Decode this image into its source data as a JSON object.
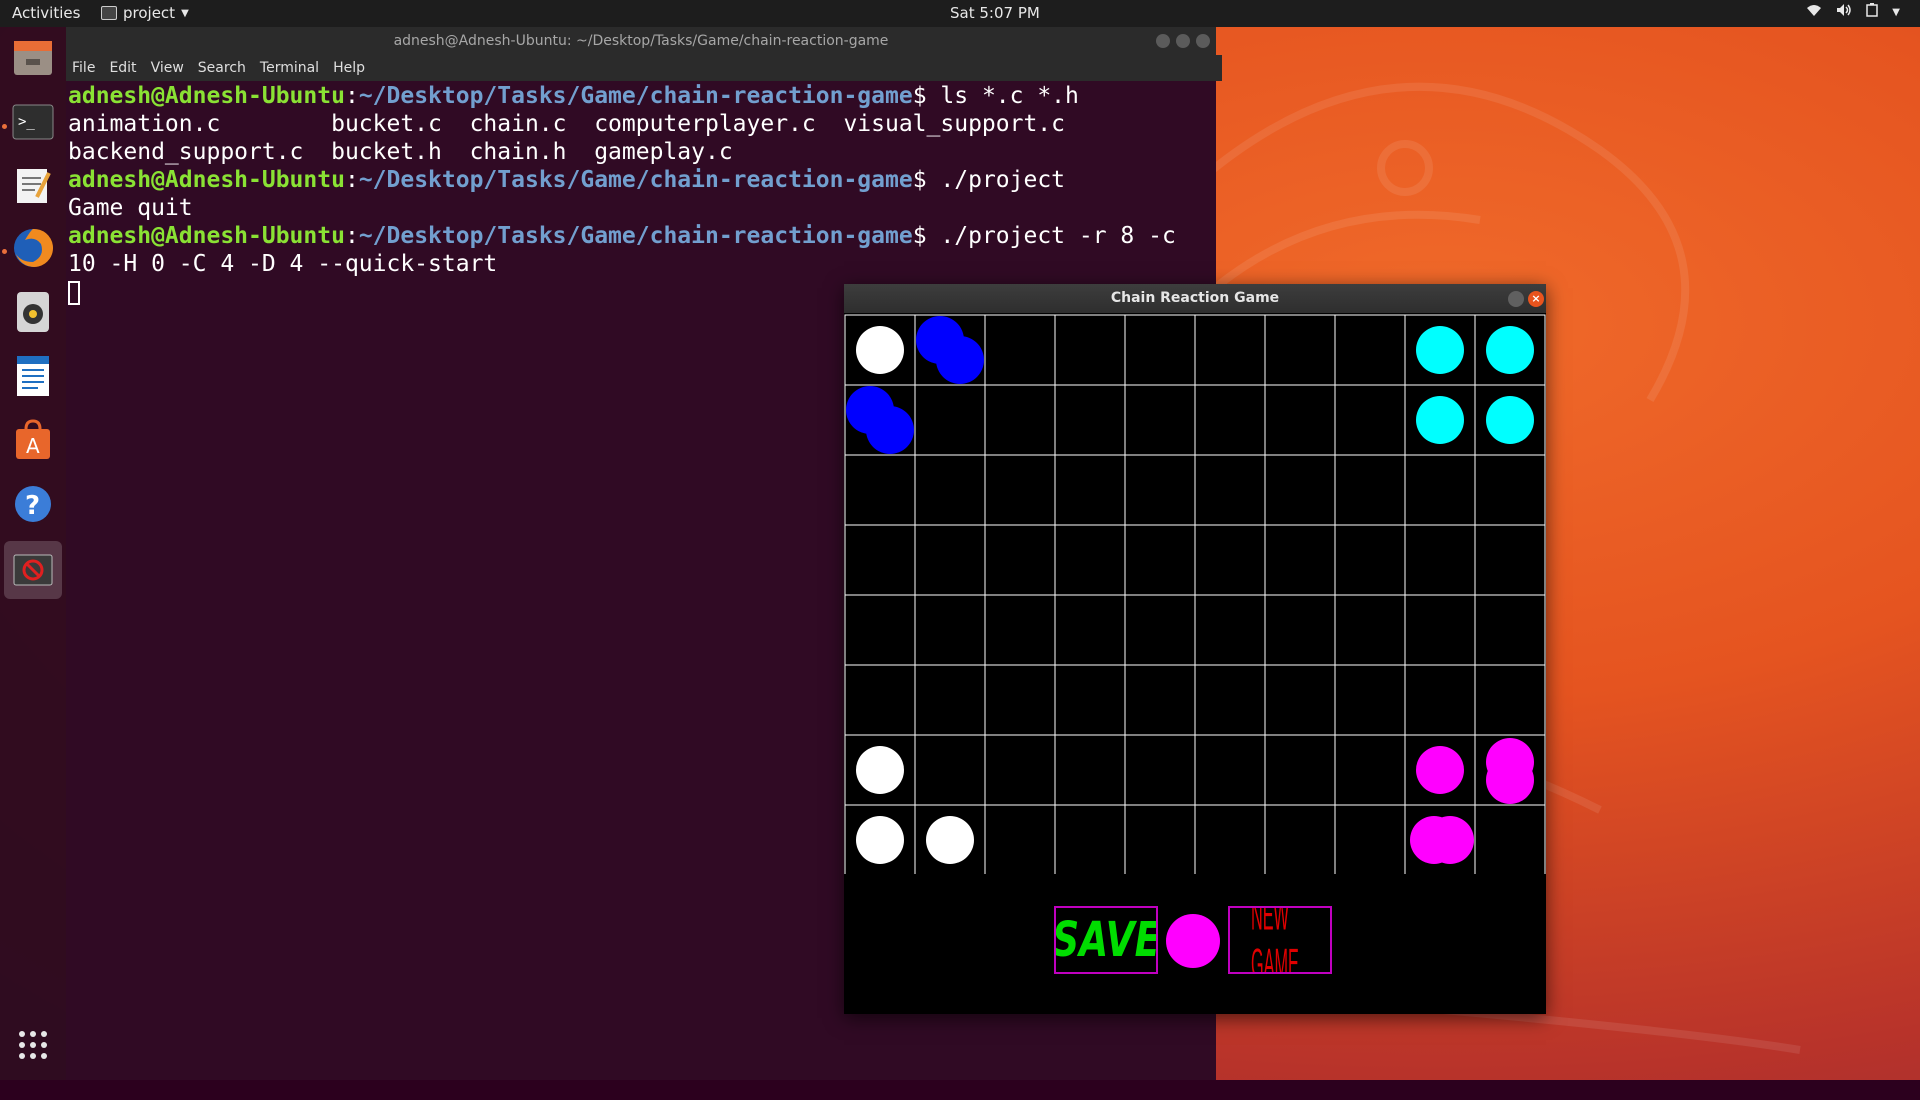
{
  "topbar": {
    "activities": "Activities",
    "app_name": "project",
    "clock": "Sat  5:07 PM"
  },
  "dock": {
    "items": [
      "files-icon",
      "terminal-icon",
      "text-editor-icon",
      "firefox-icon",
      "rhythmbox-icon",
      "libreoffice-writer-icon",
      "software-center-icon",
      "help-icon",
      "project-app-icon"
    ],
    "show_apps_icon": "app-grid-icon"
  },
  "terminal": {
    "title": "adnesh@Adnesh-Ubuntu: ~/Desktop/Tasks/Game/chain-reaction-game",
    "menu": [
      "File",
      "Edit",
      "View",
      "Search",
      "Terminal",
      "Help"
    ],
    "prompt_user": "adnesh@Adnesh-Ubuntu",
    "prompt_sep": ":",
    "prompt_path": "~/Desktop/Tasks/Game/chain-reaction-game",
    "lines": {
      "cmd1": "$ ls *.c *.h",
      "out1": "animation.c        bucket.c  chain.c  computerplayer.c  visual_support.c",
      "out2": "backend_support.c  bucket.h  chain.h  gameplay.c",
      "cmd2": "$ ./project",
      "out3": "Game quit",
      "cmd3": "$ ./project -r 8 -c",
      "out4": "10 -H 0 -C 4 -D 4 --quick-start"
    }
  },
  "game": {
    "title": "Chain Reaction Game",
    "rows": 8,
    "cols": 10,
    "player_colors": {
      "white": "#ffffff",
      "blue": "#0000ff",
      "cyan": "#00ffff",
      "magenta": "#ff00ff"
    },
    "cells": [
      {
        "r": 0,
        "c": 0,
        "color": "white",
        "count": 1
      },
      {
        "r": 0,
        "c": 1,
        "color": "blue",
        "count": 2
      },
      {
        "r": 0,
        "c": 8,
        "color": "cyan",
        "count": 1
      },
      {
        "r": 0,
        "c": 9,
        "color": "cyan",
        "count": 1
      },
      {
        "r": 1,
        "c": 0,
        "color": "blue",
        "count": 2
      },
      {
        "r": 1,
        "c": 8,
        "color": "cyan",
        "count": 1
      },
      {
        "r": 1,
        "c": 9,
        "color": "cyan",
        "count": 1
      },
      {
        "r": 6,
        "c": 0,
        "color": "white",
        "count": 1
      },
      {
        "r": 6,
        "c": 8,
        "color": "magenta",
        "count": 1
      },
      {
        "r": 6,
        "c": 9,
        "color": "magenta",
        "count": 2
      },
      {
        "r": 7,
        "c": 0,
        "color": "white",
        "count": 1
      },
      {
        "r": 7,
        "c": 1,
        "color": "white",
        "count": 1
      },
      {
        "r": 7,
        "c": 8,
        "color": "magenta",
        "count": 2
      }
    ],
    "save_label": "SAVE",
    "new_game_label": "NEW GAME",
    "current_turn_color": "#ff00ff"
  }
}
